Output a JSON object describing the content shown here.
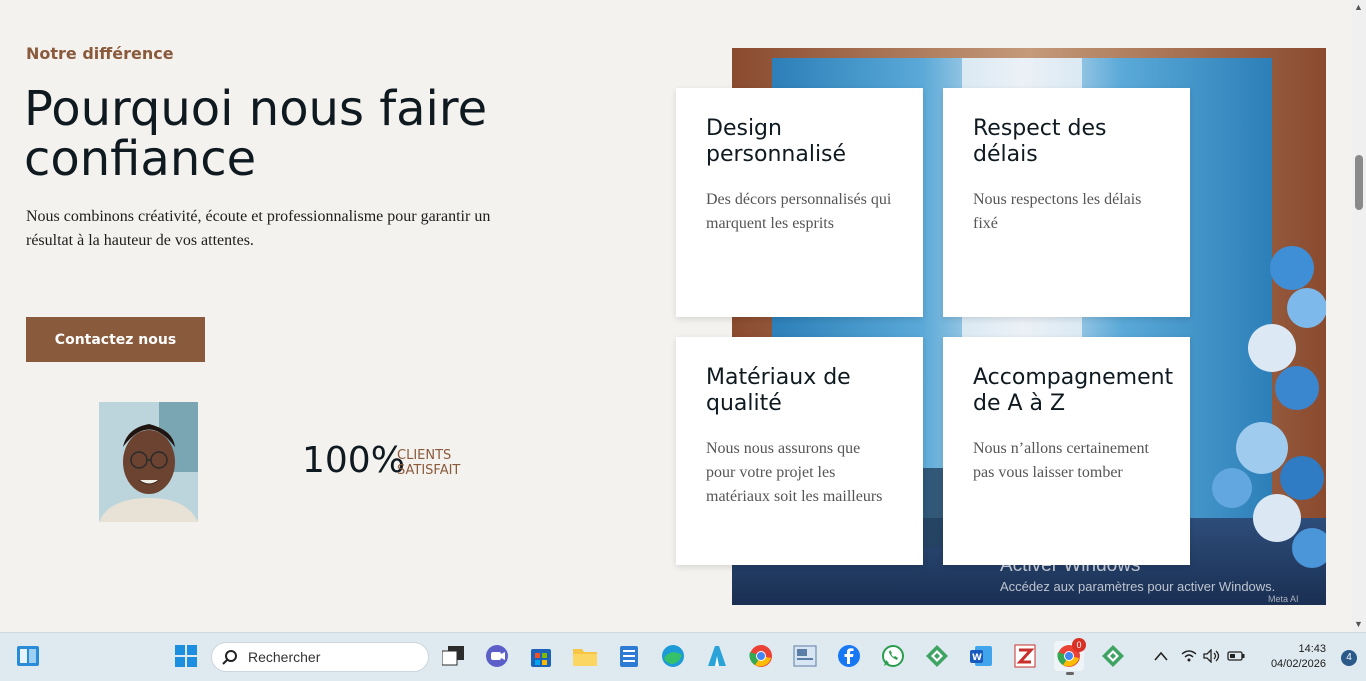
{
  "section": {
    "eyebrow": "Notre différence",
    "headline": "Pourquoi nous faire confiance",
    "intro": "Nous combinons créativité, écoute et professionnalisme pour garantir un résultat à la hauteur de vos attentes.",
    "cta_label": "Contactez nous",
    "stat_number": "100%",
    "stat_label_line1": "CLIENTS",
    "stat_label_line2": "SATISFAIT"
  },
  "cards": [
    {
      "title": "Design\npersonnalisé",
      "text": "Des décors personnalisés qui marquent les esprits"
    },
    {
      "title": "Respect des\ndélais",
      "text": "Nous respectons les délais fixé"
    },
    {
      "title": "Matériaux de\nqualité",
      "text": "Nous nous assurons que pour votre projet les matériaux soit les mailleurs"
    },
    {
      "title": "Accompagnement\nde A à Z",
      "text": "Nous n’allons certainement pas vous laisser tomber"
    }
  ],
  "watermark": {
    "line1": "Activer Windows",
    "line2": "Accédez aux paramètres pour activer Windows.",
    "meta": "Meta AI"
  },
  "taskbar": {
    "search_placeholder": "Rechercher",
    "time": "14:43",
    "date": "04/02/2026",
    "notification_count": "4",
    "chrome_badge": "0",
    "icons": [
      "widgets-icon",
      "windows-start-icon",
      "search-icon",
      "task-view-icon",
      "teams-icon",
      "store-icon",
      "file-explorer-icon",
      "notepad-icon",
      "edge-icon",
      "app-icon",
      "chrome-icon",
      "photos-icon",
      "facebook-icon",
      "whatsapp-icon",
      "app-green-icon",
      "word-icon",
      "zotero-icon",
      "chrome-profile-icon",
      "app-green2-icon"
    ]
  },
  "colors": {
    "accent": "#8a5a3c",
    "heading": "#0f1a20",
    "background": "#f4f2ef"
  }
}
